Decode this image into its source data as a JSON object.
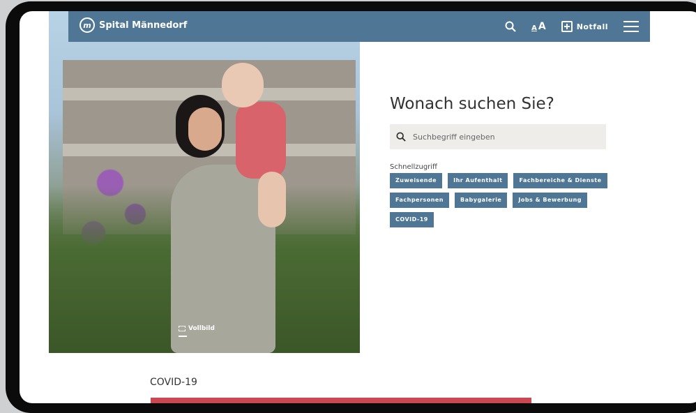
{
  "header": {
    "logo_mark": "m",
    "site_name": "Spital Männedorf",
    "font_small": "A",
    "font_big": "A",
    "emergency_label": "Notfall",
    "colors": {
      "nav_bg": "#4f7795",
      "accent_red": "#c94851"
    }
  },
  "hero": {
    "fullscreen_label": "Vollbild"
  },
  "search": {
    "title": "Wonach suchen Sie?",
    "placeholder": "Suchbegriff eingeben",
    "quick_access_label": "Schnellzugriff",
    "chips": [
      "Zuweisende",
      "Ihr Aufenthalt",
      "Fachbereiche & Dienste",
      "Fachpersonen",
      "Babygalerie",
      "Jobs & Bewerbung",
      "COVID-19"
    ]
  },
  "section": {
    "heading": "COVID-19"
  },
  "icons": [
    "logo-icon",
    "search-icon",
    "font-size-icon",
    "emergency-plus-icon",
    "menu-icon",
    "fullscreen-icon"
  ]
}
